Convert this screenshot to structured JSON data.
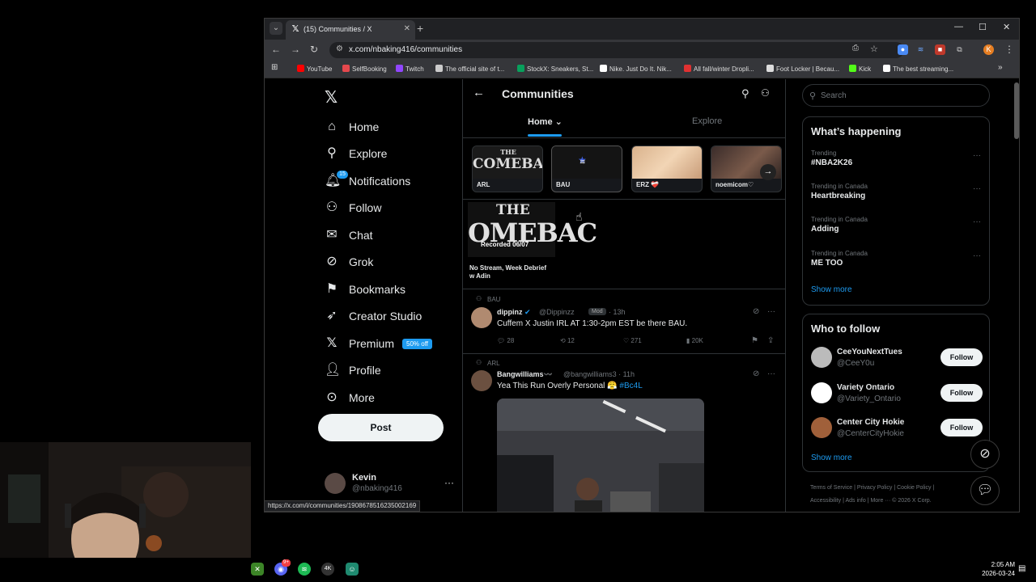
{
  "browser": {
    "tab_title": "(15) Communities / X",
    "url": "x.com/nbaking416/communities",
    "status_url": "https://x.com/i/communities/1908678516235002169",
    "bookmarks": [
      {
        "label": "YouTube",
        "color": "#ff0000"
      },
      {
        "label": "SelfBooking",
        "color": "#e5484d"
      },
      {
        "label": "Twitch",
        "color": "#9146ff"
      },
      {
        "label": "The official site of t...",
        "color": "#cccccc"
      },
      {
        "label": "StockX: Sneakers, St...",
        "color": "#08a05c"
      },
      {
        "label": "Nike. Just Do It. Nik...",
        "color": "#ffffff"
      },
      {
        "label": "All fall/winter Dropli...",
        "color": "#e03131"
      },
      {
        "label": "Foot Locker | Becau...",
        "color": "#dddddd"
      },
      {
        "label": "Kick",
        "color": "#53fc18"
      },
      {
        "label": "The best streaming...",
        "color": "#ffffff"
      }
    ]
  },
  "nav": {
    "items": [
      {
        "label": "Home",
        "icon": "home-icon"
      },
      {
        "label": "Explore",
        "icon": "search-icon"
      },
      {
        "label": "Notifications",
        "icon": "bell-icon",
        "badge": "15"
      },
      {
        "label": "Follow",
        "icon": "add-person-icon"
      },
      {
        "label": "Chat",
        "icon": "mail-icon"
      },
      {
        "label": "Grok",
        "icon": "grok-icon"
      },
      {
        "label": "Bookmarks",
        "icon": "bookmark-icon"
      },
      {
        "label": "Creator Studio",
        "icon": "rocket-icon"
      },
      {
        "label": "Premium",
        "icon": "x-icon",
        "promo": "50% off"
      },
      {
        "label": "Profile",
        "icon": "person-icon"
      },
      {
        "label": "More",
        "icon": "more-circle-icon"
      }
    ],
    "post_label": "Post",
    "account": {
      "name": "Kevin",
      "handle": "@nbaking416"
    }
  },
  "center": {
    "title": "Communities",
    "tabs": [
      {
        "label": "Home"
      },
      {
        "label": "Explore"
      }
    ],
    "communities": [
      {
        "name": "ARL"
      },
      {
        "name": "BAU"
      },
      {
        "name": "ERZ ❤️‍🩹"
      },
      {
        "name": "noemicom♡"
      }
    ],
    "community_art_text": {
      "the": "THE",
      "comeback": "COMEBACK"
    },
    "recording": {
      "art_the": "THE",
      "art_main": "OMEBAC",
      "overlay": "Recorded 06/07",
      "title": "No Stream, Week Debrief w Adin"
    },
    "posts": [
      {
        "community": "BAU",
        "name": "dippinz",
        "handle": "@Dippinzz",
        "mod": "Mod",
        "time": "· 13h",
        "text": "Cuffem X Justin IRL AT 1:30-2pm EST be there BAU.",
        "replies": "28",
        "reposts": "12",
        "likes": "271",
        "views": "20K"
      },
      {
        "community": "ARL",
        "name": "Bangwilliams〰️",
        "handle": "@bangwilliams3 · 11h",
        "text": "Yea This Run Overly Personal 😤",
        "hashtag": "#Bc4L"
      }
    ]
  },
  "right": {
    "search_placeholder": "Search",
    "whats_happening_title": "What’s happening",
    "trends": [
      {
        "context": "Trending",
        "name": "#NBA2K26"
      },
      {
        "context": "Trending in Canada",
        "name": "Heartbreaking"
      },
      {
        "context": "Trending in Canada",
        "name": "Adding"
      },
      {
        "context": "Trending in Canada",
        "name": "ME TOO"
      }
    ],
    "show_more": "Show more",
    "who_to_follow_title": "Who to follow",
    "follow_suggestions": [
      {
        "name": "CeeYouNextTues",
        "handle": "@CeeY0u",
        "button": "Follow"
      },
      {
        "name": "Variety Ontario",
        "handle": "@Variety_Ontario",
        "button": "Follow"
      },
      {
        "name": "Center City Hokie",
        "handle": "@CenterCityHokie",
        "button": "Follow"
      }
    ],
    "show_more_2": "Show more",
    "footer_line1": "Terms of Service  |  Privacy Policy  |  Cookie Policy  |",
    "footer_line2": "Accessibility  |  Ads info  |  More ···  © 2026 X Corp."
  },
  "taskbar": {
    "time": "2:05 AM",
    "date": "2026-03-24",
    "discord_badge": "9+",
    "app_4k_label": "4K"
  },
  "colors": {
    "accent": "#1d9bf0",
    "background": "#000000",
    "text": "#e7e9ea",
    "muted": "#71767b",
    "border": "#2f3336"
  }
}
